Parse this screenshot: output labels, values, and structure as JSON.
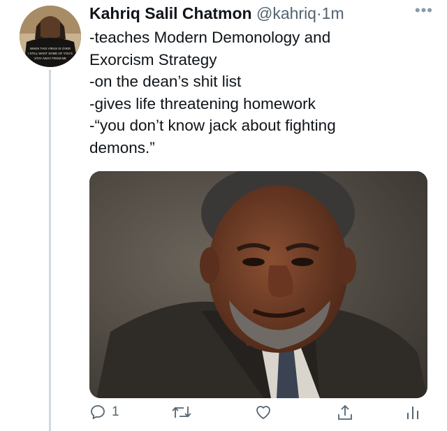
{
  "author": {
    "name": "Kahriq Salil Chatmon",
    "handle": "@kahriq",
    "separator": "·",
    "time": "1m"
  },
  "avatar_shirt_text": [
    "WHEN THIS VIRUS IS OVER",
    "I STILL WANT SOME OF YOU'S",
    "STAY AWAY FROM ME"
  ],
  "tweet": {
    "lines": [
      "-teaches Modern Demonology and",
      "Exorcism Strategy",
      "-on the dean’s shit list",
      "-gives life threatening homework",
      "-“you don’t know jack about fighting",
      "demons.”"
    ]
  },
  "actions": {
    "reply_count": "1"
  },
  "icons": {
    "more": "more-dots-icon",
    "reply": "reply-icon",
    "retweet": "retweet-icon",
    "like": "like-icon",
    "share": "share-icon",
    "analytics": "analytics-icon"
  },
  "colors": {
    "text": "#0f1419",
    "secondary": "#536471",
    "thread_line": "#cfd9de"
  }
}
